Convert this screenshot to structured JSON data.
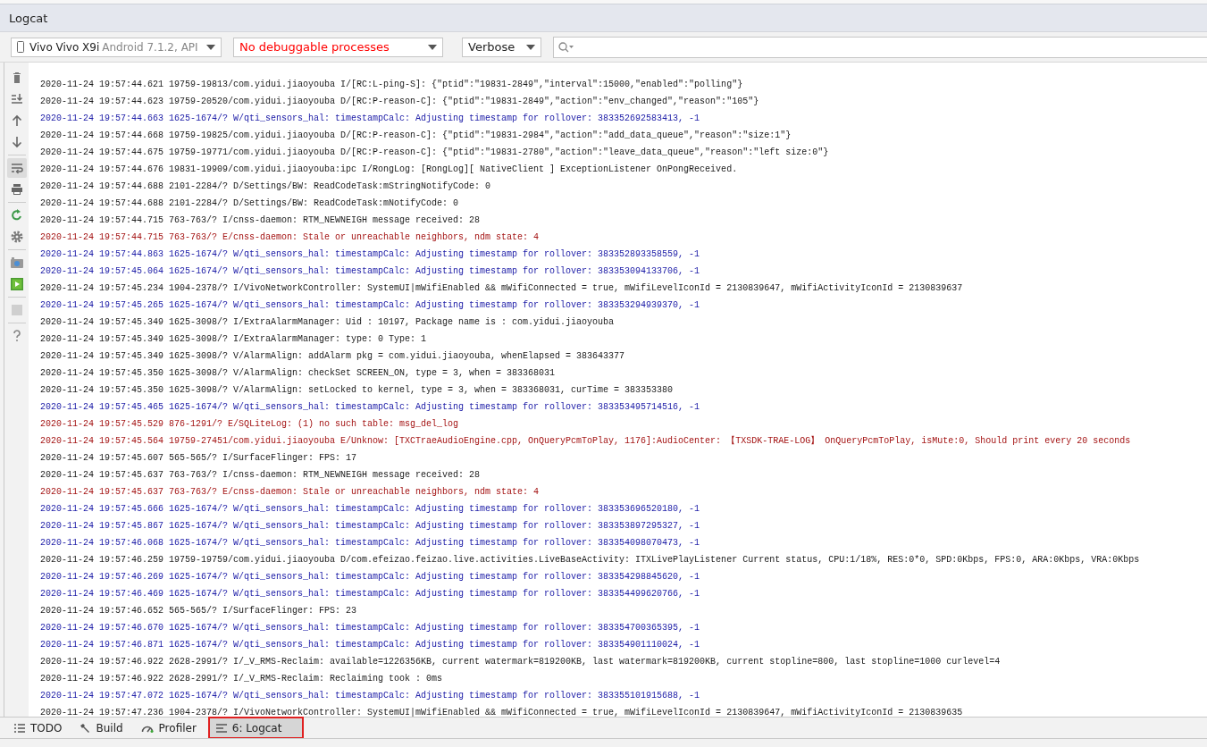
{
  "panel": {
    "title": "Logcat"
  },
  "toolbar": {
    "device": {
      "name": "Vivo Vivo X9i",
      "detail": "Android 7.1.2, API"
    },
    "process": {
      "value": "No debuggable processes"
    },
    "log_level": {
      "value": "Verbose"
    }
  },
  "side_toolbar": [
    {
      "on": false
    },
    {
      "on": false
    },
    {
      "on": false
    },
    {
      "on": false
    },
    {
      "on": true
    },
    {
      "on": false
    },
    {
      "on": false
    },
    {
      "on": false
    },
    {
      "on": false
    },
    {
      "on": false
    },
    {
      "on": false
    },
    {
      "on": false
    }
  ],
  "log_lines": [
    {
      "kind": "info",
      "text": "2020-11-24 19:57:44.621 19759-19813/com.yidui.jiaoyouba I/[RC:L-ping-S]: {\"ptid\":\"19831-2849\",\"interval\":15000,\"enabled\":\"polling\"}"
    },
    {
      "kind": "info",
      "text": "2020-11-24 19:57:44.623 19759-20520/com.yidui.jiaoyouba D/[RC:P-reason-C]: {\"ptid\":\"19831-2849\",\"action\":\"env_changed\",\"reason\":\"105\"}"
    },
    {
      "kind": "warning",
      "text": "2020-11-24 19:57:44.663 1625-1674/? W/qti_sensors_hal: timestampCalc: Adjusting timestamp for rollover: 383352692583413, -1"
    },
    {
      "kind": "info",
      "text": "2020-11-24 19:57:44.668 19759-19825/com.yidui.jiaoyouba D/[RC:P-reason-C]: {\"ptid\":\"19831-2984\",\"action\":\"add_data_queue\",\"reason\":\"size:1\"}"
    },
    {
      "kind": "info",
      "text": "2020-11-24 19:57:44.675 19759-19771/com.yidui.jiaoyouba D/[RC:P-reason-C]: {\"ptid\":\"19831-2780\",\"action\":\"leave_data_queue\",\"reason\":\"left size:0\"}"
    },
    {
      "kind": "info",
      "text": "2020-11-24 19:57:44.676 19831-19909/com.yidui.jiaoyouba:ipc I/RongLog: [RongLog][ NativeClient ] ExceptionListener OnPongReceived."
    },
    {
      "kind": "info",
      "text": "2020-11-24 19:57:44.688 2101-2284/? D/Settings/BW: ReadCodeTask:mStringNotifyCode: 0"
    },
    {
      "kind": "info",
      "text": "2020-11-24 19:57:44.688 2101-2284/? D/Settings/BW: ReadCodeTask:mNotifyCode: 0"
    },
    {
      "kind": "info",
      "text": "2020-11-24 19:57:44.715 763-763/? I/cnss-daemon: RTM_NEWNEIGH message received: 28"
    },
    {
      "kind": "error",
      "text": "2020-11-24 19:57:44.715 763-763/? E/cnss-daemon: Stale or unreachable neighbors, ndm state: 4"
    },
    {
      "kind": "warning",
      "text": "2020-11-24 19:57:44.863 1625-1674/? W/qti_sensors_hal: timestampCalc: Adjusting timestamp for rollover: 383352893358559, -1"
    },
    {
      "kind": "warning",
      "text": "2020-11-24 19:57:45.064 1625-1674/? W/qti_sensors_hal: timestampCalc: Adjusting timestamp for rollover: 383353094133706, -1"
    },
    {
      "kind": "info",
      "text": "2020-11-24 19:57:45.234 1904-2378/? I/VivoNetworkController: SystemUI|mWifiEnabled && mWifiConnected = true, mWifiLevelIconId = 2130839647, mWifiActivityIconId = 2130839637"
    },
    {
      "kind": "warning",
      "text": "2020-11-24 19:57:45.265 1625-1674/? W/qti_sensors_hal: timestampCalc: Adjusting timestamp for rollover: 383353294939370, -1"
    },
    {
      "kind": "info",
      "text": "2020-11-24 19:57:45.349 1625-3098/? I/ExtraAlarmManager: Uid : 10197, Package name is : com.yidui.jiaoyouba"
    },
    {
      "kind": "info",
      "text": "2020-11-24 19:57:45.349 1625-3098/? I/ExtraAlarmManager: type: 0 Type: 1"
    },
    {
      "kind": "info",
      "text": "2020-11-24 19:57:45.349 1625-3098/? V/AlarmAlign: addAlarm pkg = com.yidui.jiaoyouba, whenElapsed = 383643377"
    },
    {
      "kind": "info",
      "text": "2020-11-24 19:57:45.350 1625-3098/? V/AlarmAlign: checkSet SCREEN_ON, type = 3, when = 383368031"
    },
    {
      "kind": "info",
      "text": "2020-11-24 19:57:45.350 1625-3098/? V/AlarmAlign: setLocked to kernel, type = 3, when = 383368031, curTime = 383353380"
    },
    {
      "kind": "warning",
      "text": "2020-11-24 19:57:45.465 1625-1674/? W/qti_sensors_hal: timestampCalc: Adjusting timestamp for rollover: 383353495714516, -1"
    },
    {
      "kind": "error",
      "text": "2020-11-24 19:57:45.529 876-1291/? E/SQLiteLog: (1) no such table: msg_del_log"
    },
    {
      "kind": "error",
      "text": "2020-11-24 19:57:45.564 19759-27451/com.yidui.jiaoyouba E/Unknow: [TXCTraeAudioEngine.cpp, OnQueryPcmToPlay, 1176]:AudioCenter: 【TXSDK-TRAE-LOG】 OnQueryPcmToPlay, isMute:0, Should print every 20 seconds"
    },
    {
      "kind": "info",
      "text": "2020-11-24 19:57:45.607 565-565/? I/SurfaceFlinger: FPS: 17"
    },
    {
      "kind": "info",
      "text": "2020-11-24 19:57:45.637 763-763/? I/cnss-daemon: RTM_NEWNEIGH message received: 28"
    },
    {
      "kind": "error",
      "text": "2020-11-24 19:57:45.637 763-763/? E/cnss-daemon: Stale or unreachable neighbors, ndm state: 4"
    },
    {
      "kind": "warning",
      "text": "2020-11-24 19:57:45.666 1625-1674/? W/qti_sensors_hal: timestampCalc: Adjusting timestamp for rollover: 383353696520180, -1"
    },
    {
      "kind": "warning",
      "text": "2020-11-24 19:57:45.867 1625-1674/? W/qti_sensors_hal: timestampCalc: Adjusting timestamp for rollover: 383353897295327, -1"
    },
    {
      "kind": "warning",
      "text": "2020-11-24 19:57:46.068 1625-1674/? W/qti_sensors_hal: timestampCalc: Adjusting timestamp for rollover: 383354098070473, -1"
    },
    {
      "kind": "info",
      "text": "2020-11-24 19:57:46.259 19759-19759/com.yidui.jiaoyouba D/com.efeizao.feizao.live.activities.LiveBaseActivity: ITXLivePlayListener Current status, CPU:1/18%, RES:0*0, SPD:0Kbps, FPS:0, ARA:0Kbps, VRA:0Kbps"
    },
    {
      "kind": "warning",
      "text": "2020-11-24 19:57:46.269 1625-1674/? W/qti_sensors_hal: timestampCalc: Adjusting timestamp for rollover: 383354298845620, -1"
    },
    {
      "kind": "warning",
      "text": "2020-11-24 19:57:46.469 1625-1674/? W/qti_sensors_hal: timestampCalc: Adjusting timestamp for rollover: 383354499620766, -1"
    },
    {
      "kind": "info",
      "text": "2020-11-24 19:57:46.652 565-565/? I/SurfaceFlinger: FPS: 23"
    },
    {
      "kind": "warning",
      "text": "2020-11-24 19:57:46.670 1625-1674/? W/qti_sensors_hal: timestampCalc: Adjusting timestamp for rollover: 383354700365395, -1"
    },
    {
      "kind": "warning",
      "text": "2020-11-24 19:57:46.871 1625-1674/? W/qti_sensors_hal: timestampCalc: Adjusting timestamp for rollover: 383354901110024, -1"
    },
    {
      "kind": "info",
      "text": "2020-11-24 19:57:46.922 2628-2991/? I/_V_RMS-Reclaim: available=1226356KB, current watermark=819200KB, last watermark=819200KB, current stopline=800, last stopline=1000 curlevel=4"
    },
    {
      "kind": "info",
      "text": "2020-11-24 19:57:46.922 2628-2991/? I/_V_RMS-Reclaim: Reclaiming took : 0ms"
    },
    {
      "kind": "warning",
      "text": "2020-11-24 19:57:47.072 1625-1674/? W/qti_sensors_hal: timestampCalc: Adjusting timestamp for rollover: 383355101915688, -1"
    },
    {
      "kind": "info",
      "text": "2020-11-24 19:57:47.236 1904-2378/? I/VivoNetworkController: SystemUI|mWifiEnabled && mWifiConnected = true, mWifiLevelIconId = 2130839647, mWifiActivityIconId = 2130839635"
    }
  ],
  "bottom_tabs": [
    {
      "label": "TODO",
      "selected": false
    },
    {
      "label": "Build",
      "selected": false
    },
    {
      "label": "Profiler",
      "selected": false
    },
    {
      "label": "6: Logcat",
      "selected": true
    }
  ]
}
